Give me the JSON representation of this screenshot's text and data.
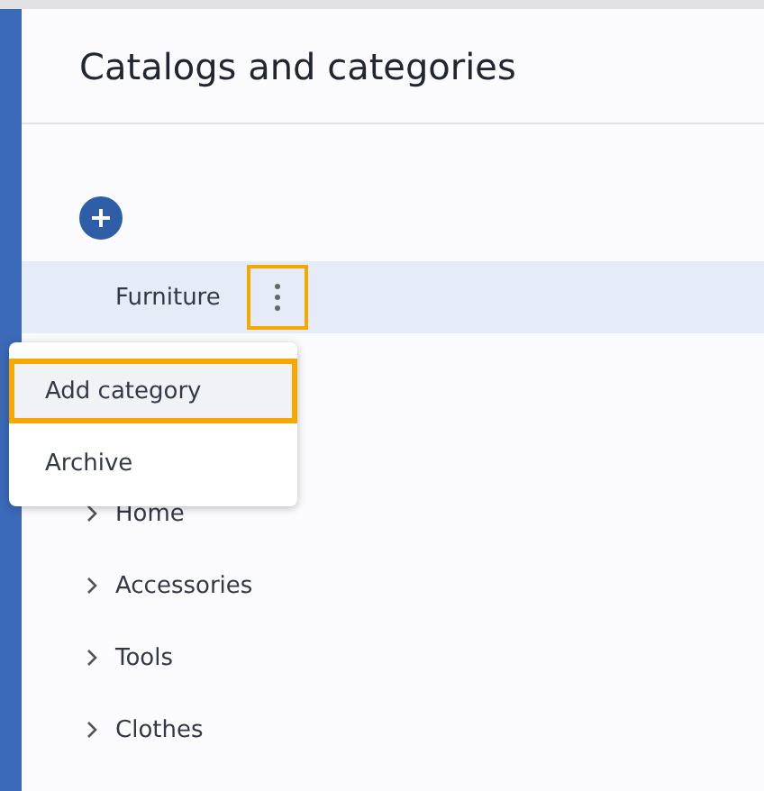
{
  "header": {
    "title": "Catalogs and categories"
  },
  "tree": [
    {
      "label": "Furniture",
      "selected": true,
      "expandable": false,
      "menu_button": {
        "highlighted": true
      }
    },
    {
      "label": "Home",
      "selected": false,
      "expandable": true
    },
    {
      "label": "Accessories",
      "selected": false,
      "expandable": true
    },
    {
      "label": "Tools",
      "selected": false,
      "expandable": true
    },
    {
      "label": "Clothes",
      "selected": false,
      "expandable": true
    }
  ],
  "context_menu": {
    "items": [
      {
        "label": "Add category",
        "highlighted": true
      },
      {
        "label": "Archive",
        "highlighted": false
      }
    ]
  }
}
